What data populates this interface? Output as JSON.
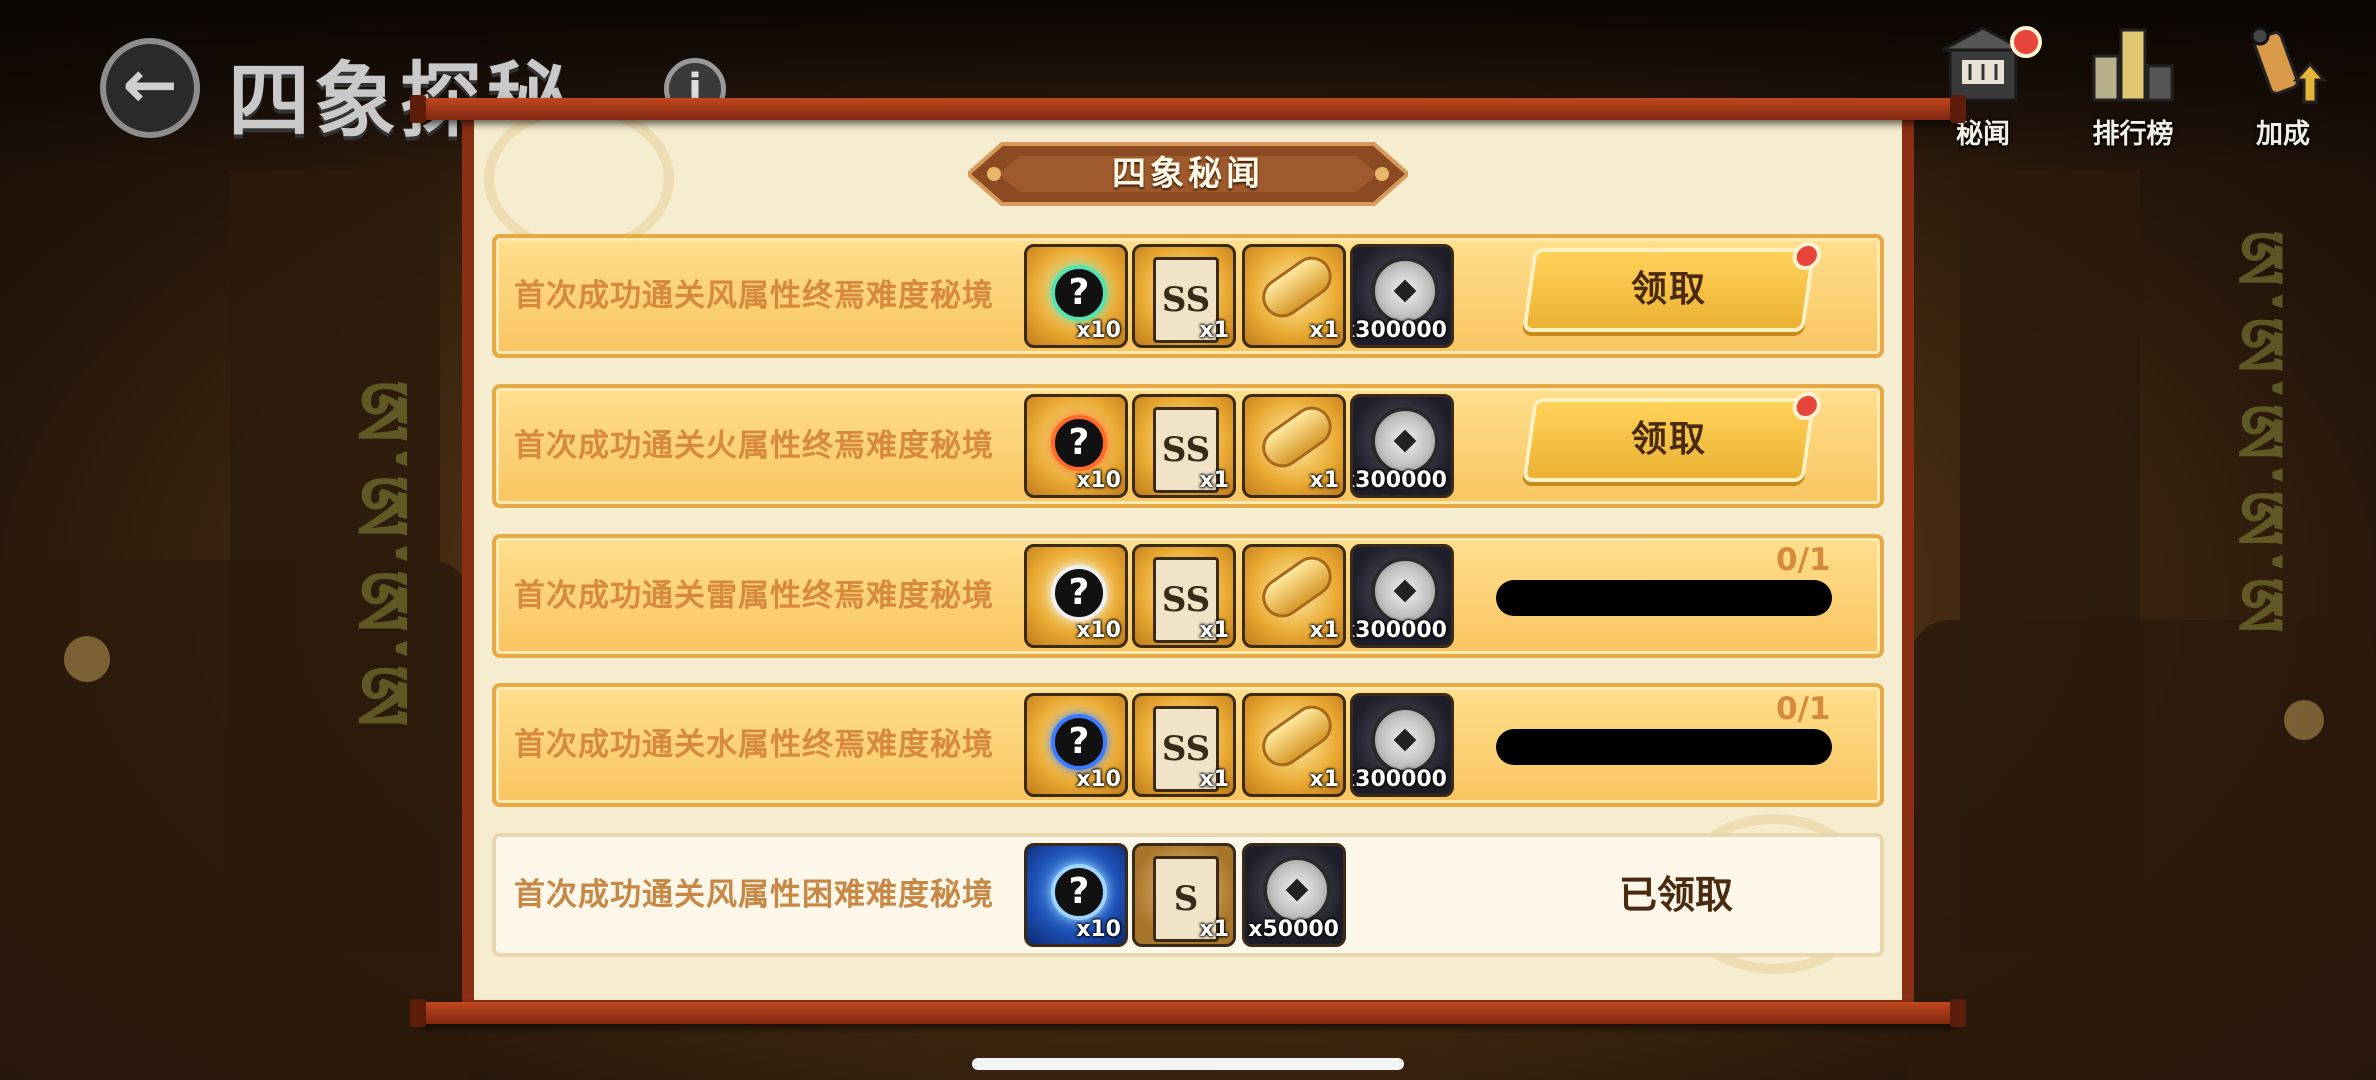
{
  "header": {
    "back_icon": "arrow-left-icon",
    "title": "四象探秘",
    "info_icon": "info-icon",
    "info_glyph": "i"
  },
  "top_nav": [
    {
      "label": "秘闻",
      "icon": "scroll-house-icon",
      "badge": true
    },
    {
      "label": "排行榜",
      "icon": "leaderboard-icon",
      "badge": false
    },
    {
      "label": "加成",
      "icon": "boost-scroll-icon",
      "badge": false
    }
  ],
  "panel": {
    "title": "四象秘闻"
  },
  "rows": [
    {
      "description": "首次成功通关风属性终焉难度秘境",
      "state": "claimable",
      "action_label": "领取",
      "badge": true,
      "rewards": [
        {
          "icon": "mystery-orb-wind-icon",
          "qty": "x10",
          "style": "gold"
        },
        {
          "icon": "ss-scroll-card-icon",
          "qty": "x1",
          "style": "gold"
        },
        {
          "icon": "golden-scroll-icon",
          "qty": "x1",
          "style": "gold"
        },
        {
          "icon": "silver-coin-icon",
          "qty": "x300000",
          "style": "dark"
        }
      ]
    },
    {
      "description": "首次成功通关火属性终焉难度秘境",
      "state": "claimable",
      "action_label": "领取",
      "badge": true,
      "rewards": [
        {
          "icon": "mystery-orb-fire-icon",
          "qty": "x10",
          "style": "gold"
        },
        {
          "icon": "ss-scroll-card-icon",
          "qty": "x1",
          "style": "gold"
        },
        {
          "icon": "golden-scroll-icon",
          "qty": "x1",
          "style": "gold"
        },
        {
          "icon": "silver-coin-icon",
          "qty": "x300000",
          "style": "dark"
        }
      ]
    },
    {
      "description": "首次成功通关雷属性终焉难度秘境",
      "state": "progress",
      "progress_label": "0/1",
      "progress_value": 0,
      "rewards": [
        {
          "icon": "mystery-orb-thunder-icon",
          "qty": "x10",
          "style": "gold"
        },
        {
          "icon": "ss-scroll-card-icon",
          "qty": "x1",
          "style": "gold"
        },
        {
          "icon": "golden-scroll-icon",
          "qty": "x1",
          "style": "gold"
        },
        {
          "icon": "silver-coin-icon",
          "qty": "x300000",
          "style": "dark"
        }
      ]
    },
    {
      "description": "首次成功通关水属性终焉难度秘境",
      "state": "progress",
      "progress_label": "0/1",
      "progress_value": 0,
      "rewards": [
        {
          "icon": "mystery-orb-water-icon",
          "qty": "x10",
          "style": "gold"
        },
        {
          "icon": "ss-scroll-card-icon",
          "qty": "x1",
          "style": "gold"
        },
        {
          "icon": "golden-scroll-icon",
          "qty": "x1",
          "style": "gold"
        },
        {
          "icon": "silver-coin-icon",
          "qty": "x300000",
          "style": "dark"
        }
      ]
    },
    {
      "description": "首次成功通关风属性困难难度秘境",
      "state": "claimed",
      "claimed_label": "已领取",
      "rewards": [
        {
          "icon": "mystery-orb-blue-icon",
          "qty": "x10",
          "style": "blue"
        },
        {
          "icon": "s-scroll-card-icon",
          "qty": "x1",
          "style": "brown"
        },
        {
          "icon": "silver-coin-icon",
          "qty": "x50000",
          "style": "dark"
        }
      ]
    }
  ],
  "glyphs": {
    "orb": "?",
    "ss_card": "SS",
    "s_card": "S"
  },
  "colors": {
    "row_active_bg": "#f8c560",
    "row_done_bg": "#fdf7ea",
    "claim_button": "#ebb233",
    "badge_red": "#e8453a",
    "description_text": "#d88a3c"
  }
}
